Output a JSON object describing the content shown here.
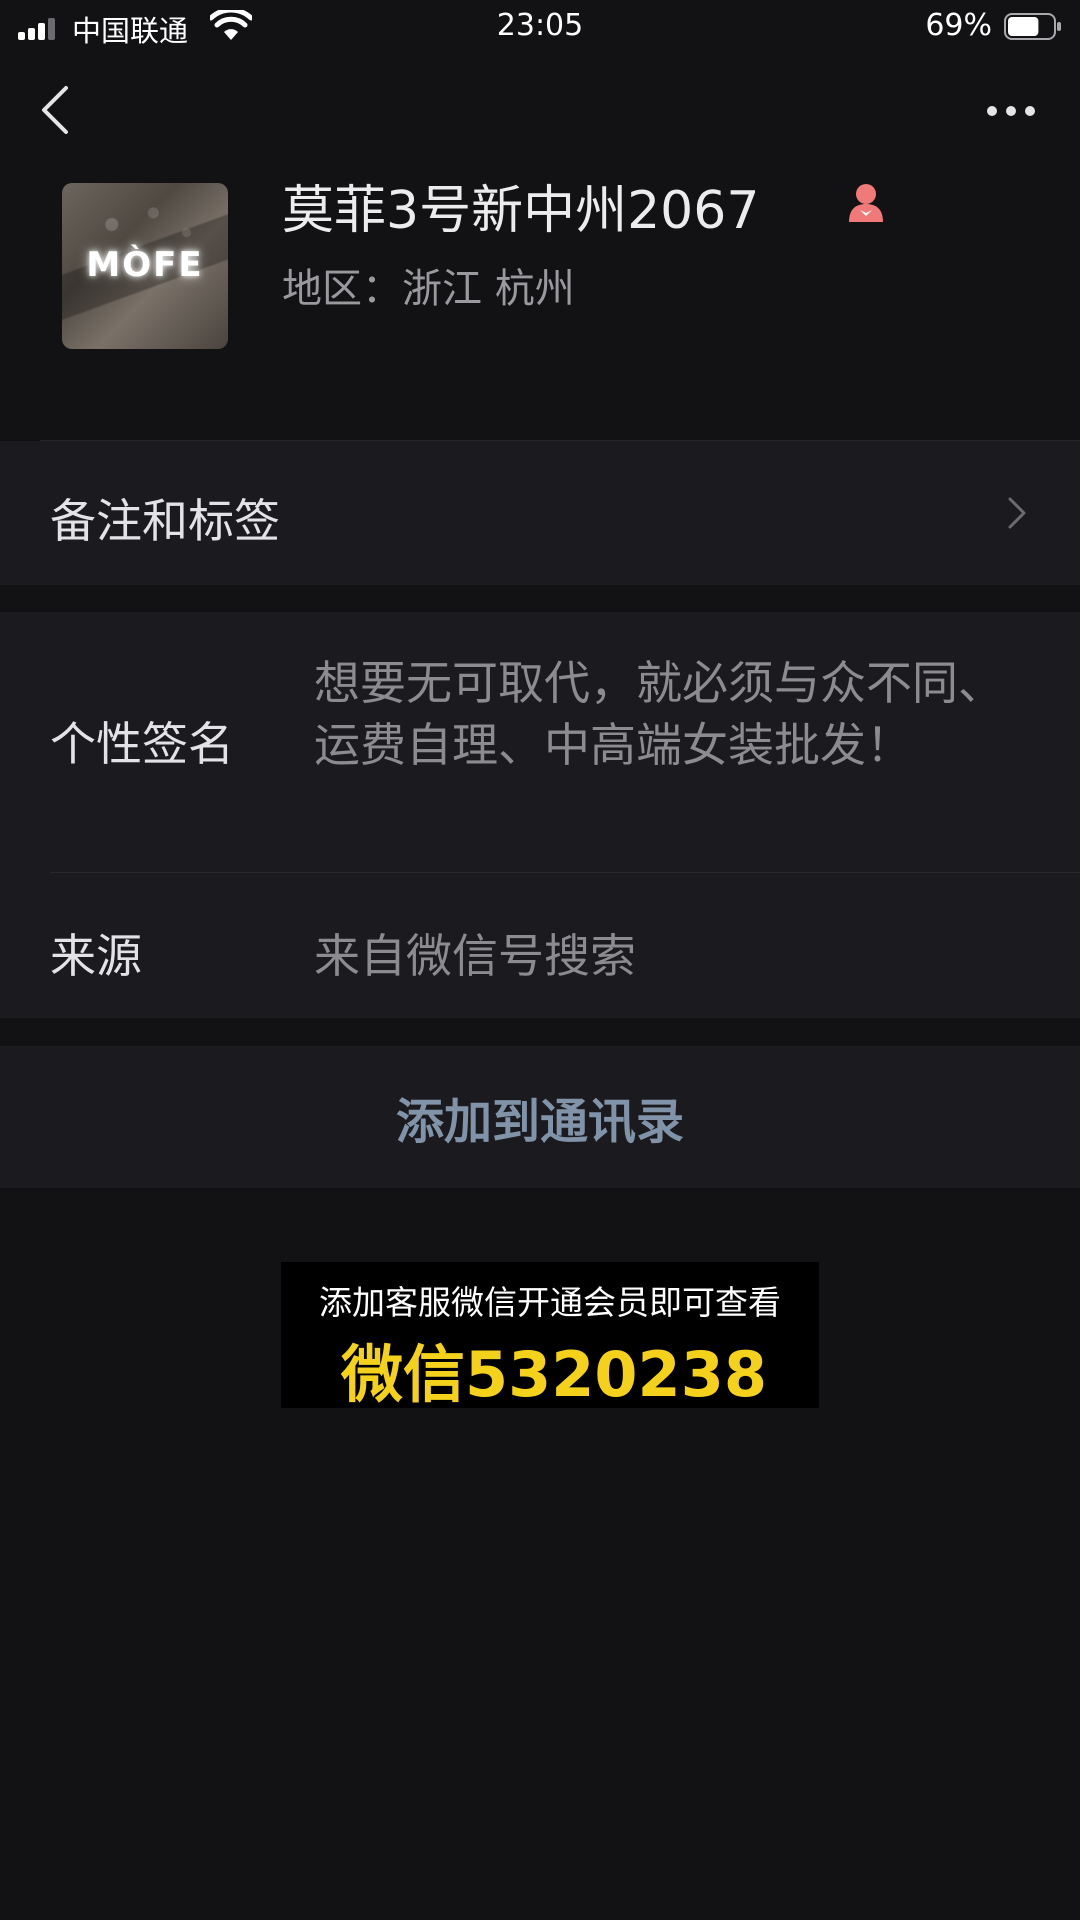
{
  "status_bar": {
    "carrier": "中国联通",
    "time": "23:05",
    "battery_percent": "69%",
    "battery_level": 0.69,
    "signal_bars_active": 3,
    "signal_bars_total": 4
  },
  "nav": {
    "back_icon": "chevron-left-icon",
    "more_icon": "more-dots-icon"
  },
  "profile": {
    "avatar_text": "MÒFE",
    "display_name": "莫菲3号新中州2067",
    "gender_icon": "female-icon",
    "gender_color": "#f07a7a",
    "region": "地区：浙江 杭州"
  },
  "rows": {
    "remarks_label": "备注和标签",
    "signature_label": "个性签名",
    "signature_value": "想要无可取代，就必须与众不同、运费自理、中高端女装批发！",
    "source_label": "来源",
    "source_value": "来自微信号搜索"
  },
  "actions": {
    "add_contact_label": "添加到通讯录",
    "accent_color": "#8193a8"
  },
  "overlay": {
    "line1": "添加客服微信开通会员即可查看",
    "line2": "微信5320238",
    "highlight_color": "#f4d21c"
  }
}
